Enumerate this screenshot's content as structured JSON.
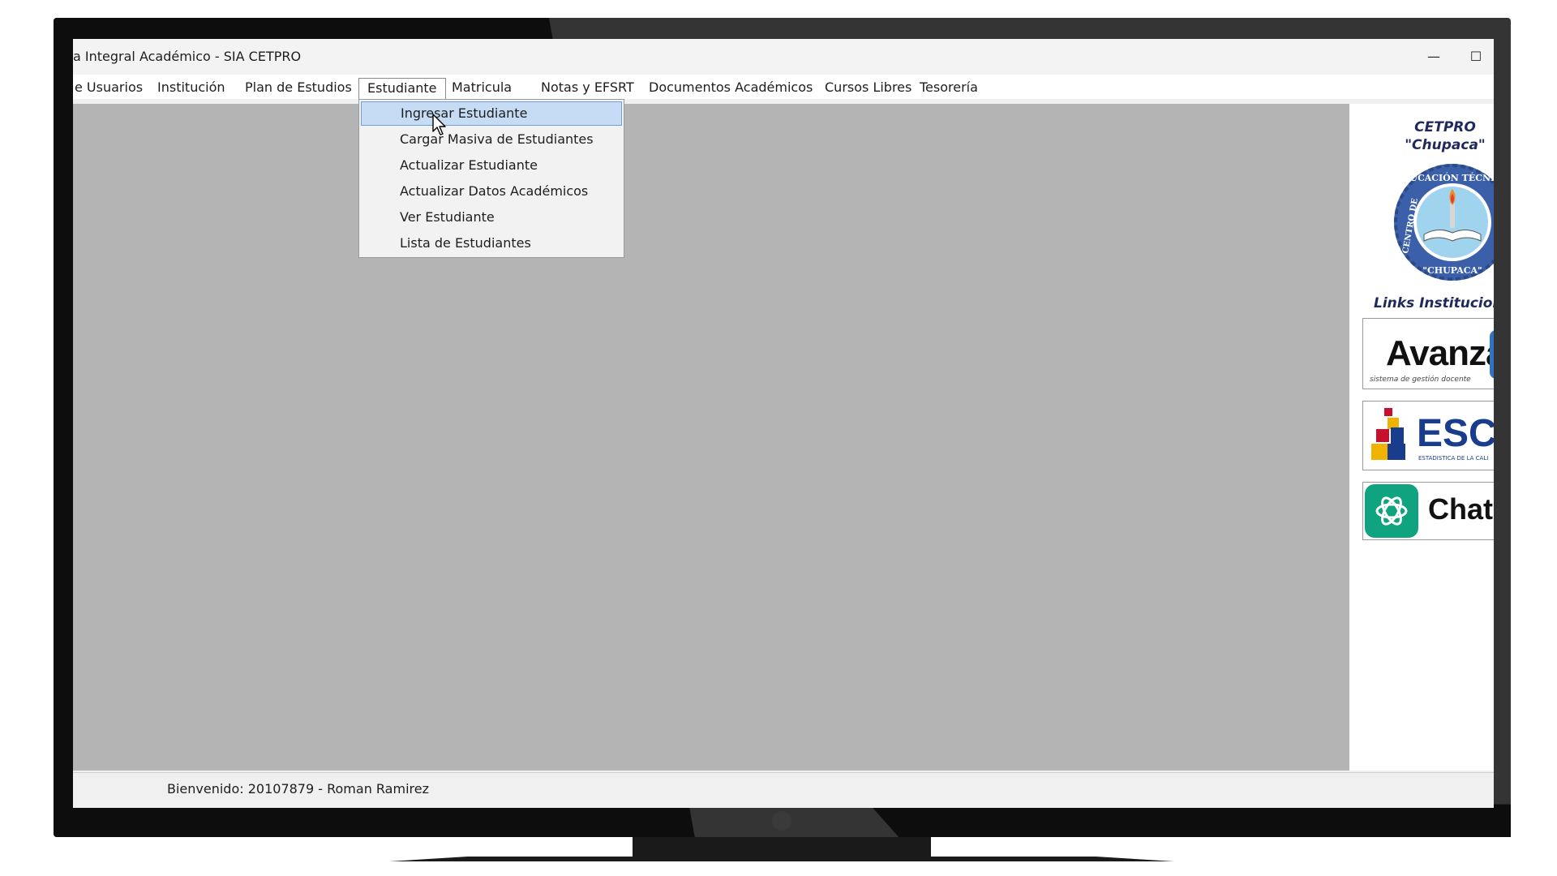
{
  "window": {
    "title": "a Integral Académico - SIA CETPRO",
    "minimize_glyph": "—",
    "maximize_glyph": "☐"
  },
  "menubar": {
    "items": [
      {
        "label": "e Usuarios"
      },
      {
        "label": "Institución"
      },
      {
        "label": "Plan de Estudios"
      },
      {
        "label": "Estudiante"
      },
      {
        "label": "Matricula"
      },
      {
        "label": "Notas y EFSRT"
      },
      {
        "label": "Documentos Académicos"
      },
      {
        "label": "Cursos Libres"
      },
      {
        "label": "Tesorería"
      }
    ],
    "active": "Estudiante"
  },
  "dropdown": {
    "items": [
      {
        "label": "Ingresar Estudiante"
      },
      {
        "label": "Cargar Masiva de Estudiantes"
      },
      {
        "label": "Actualizar Estudiante"
      },
      {
        "label": "Actualizar Datos Académicos"
      },
      {
        "label": "Ver Estudiante"
      },
      {
        "label": "Lista de Estudiantes"
      }
    ],
    "hovered": "Ingresar Estudiante"
  },
  "sidebar": {
    "institution_line1": "CETPRO",
    "institution_line2": "\"Chupaca\"",
    "seal_top_text": "EDUCACIÓN TÉCNICO",
    "seal_left_text": "CENTRO DE",
    "seal_bottom_text": "\"CHUPACA\"",
    "links_title": "Links Institucion",
    "links": [
      {
        "name": "Avanza",
        "subtitle": "sistema de gestión docente"
      },
      {
        "name": "ESCA",
        "subtitle": "ESTADISTICA DE LA CALI"
      },
      {
        "name": "Chat("
      }
    ]
  },
  "status": {
    "welcome": "Bienvenido: 20107879 - Roman Ramirez"
  },
  "colors": {
    "workspace": "#b4b4b4",
    "menu_hover": "#c5dcf4",
    "institution_text": "#1f2a5a",
    "seal_blue": "#3b5fa8",
    "chatgpt_green": "#10a37f"
  }
}
